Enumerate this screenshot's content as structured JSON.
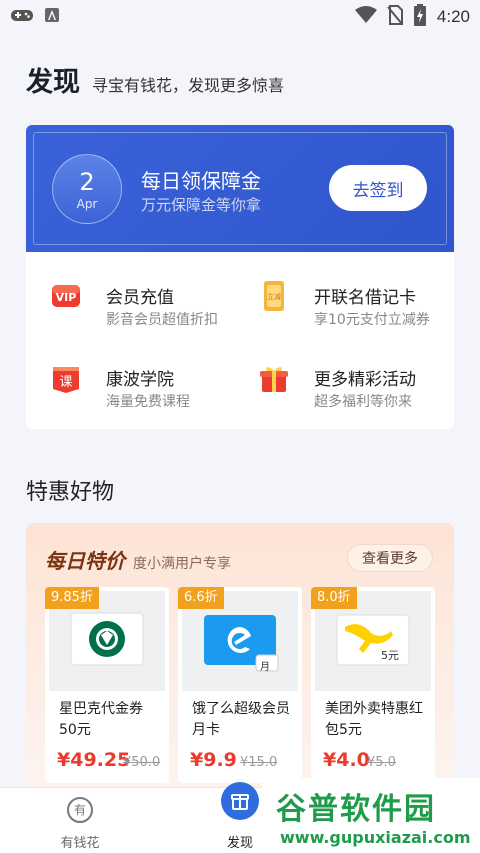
{
  "status_bar": {
    "time": "4:20"
  },
  "header": {
    "title": "发现",
    "subtitle": "寻宝有钱花，发现更多惊喜"
  },
  "banner": {
    "day": "2",
    "month": "Apr",
    "title": "每日领保障金",
    "subtitle": "万元保障金等你拿",
    "button": "去签到"
  },
  "services": [
    {
      "title": "会员充值",
      "subtitle": "影音会员超值折扣",
      "icon": "vip-icon"
    },
    {
      "title": "开联名借记卡",
      "subtitle": "享10元支付立减券",
      "icon": "coupon-icon"
    },
    {
      "title": "康波学院",
      "subtitle": "海量免费课程",
      "icon": "course-book-icon"
    },
    {
      "title": "更多精彩活动",
      "subtitle": "超多福利等你来",
      "icon": "gift-icon"
    }
  ],
  "section": {
    "title": "特惠好物"
  },
  "deals": {
    "title": "每日特价",
    "subtitle": "度小满用户专享",
    "more": "查看更多",
    "products": [
      {
        "discount": "9.85折",
        "name": "星巴克代金券50元",
        "price": "¥49.25",
        "original": "¥50.0",
        "icon": "starbucks-logo-icon"
      },
      {
        "discount": "6.6折",
        "name": "饿了么超级会员月卡",
        "price": "¥9.9",
        "original": "¥15.0",
        "icon": "eleme-logo-icon",
        "card_label": "月"
      },
      {
        "discount": "8.0折",
        "name": "美团外卖特惠红包5元",
        "price": "¥4.0",
        "original": "¥5.0",
        "icon": "meituan-kangaroo-icon",
        "card_label": "5元"
      }
    ]
  },
  "nav": {
    "items": [
      {
        "label": "有钱花",
        "icon_text": "有"
      },
      {
        "label": "发现"
      }
    ]
  },
  "watermark": {
    "text": "谷普软件园",
    "url": "www.gupuxiazai.com"
  },
  "colors": {
    "brand_blue": "#2f55cc",
    "price_red": "#ec3a2c",
    "discount_orange": "#f2a11c",
    "watermark_green": "#1f9c4a"
  }
}
